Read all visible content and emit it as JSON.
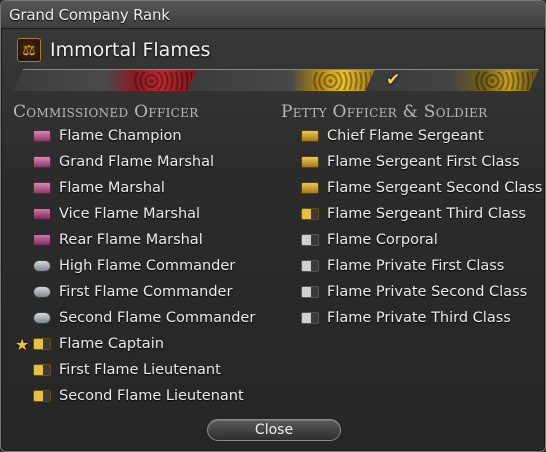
{
  "window": {
    "title": "Grand Company Rank"
  },
  "company": {
    "name": "Immortal Flames",
    "emblem_icon": "flames-emblem-icon"
  },
  "rank_progress": {
    "segments": 3,
    "current_segment": 3
  },
  "commissioned": {
    "heading": "Commissioned Officer",
    "ranks": [
      {
        "label": "Flame Champion",
        "icon": "pink"
      },
      {
        "label": "Grand Flame Marshal",
        "icon": "pink"
      },
      {
        "label": "Flame Marshal",
        "icon": "pink"
      },
      {
        "label": "Vice Flame Marshal",
        "icon": "pink2"
      },
      {
        "label": "Rear Flame Marshal",
        "icon": "pink2"
      },
      {
        "label": "High Flame Commander",
        "icon": "wing"
      },
      {
        "label": "First Flame Commander",
        "icon": "wing"
      },
      {
        "label": "Second Flame Commander",
        "icon": "wing"
      },
      {
        "label": "Flame Captain",
        "icon": "gold-bar",
        "current": true
      },
      {
        "label": "First Flame Lieutenant",
        "icon": "gold-bar"
      },
      {
        "label": "Second Flame Lieutenant",
        "icon": "gold-bar"
      }
    ]
  },
  "petty": {
    "heading": "Petty Officer & Soldier",
    "ranks": [
      {
        "label": "Chief Flame Sergeant",
        "icon": "chev-gold"
      },
      {
        "label": "Flame Sergeant First Class",
        "icon": "chev-gold"
      },
      {
        "label": "Flame Sergeant Second Class",
        "icon": "chev-gold"
      },
      {
        "label": "Flame Sergeant Third Class",
        "icon": "gold-bar"
      },
      {
        "label": "Flame Corporal",
        "icon": "silver-bar"
      },
      {
        "label": "Flame Private First Class",
        "icon": "silver-bar"
      },
      {
        "label": "Flame Private Second Class",
        "icon": "silver-bar"
      },
      {
        "label": "Flame Private Third Class",
        "icon": "silver-bar"
      }
    ]
  },
  "buttons": {
    "close_label": "Close"
  },
  "colors": {
    "accent_gold": "#f0c440",
    "current_marker": "#f0c440"
  }
}
